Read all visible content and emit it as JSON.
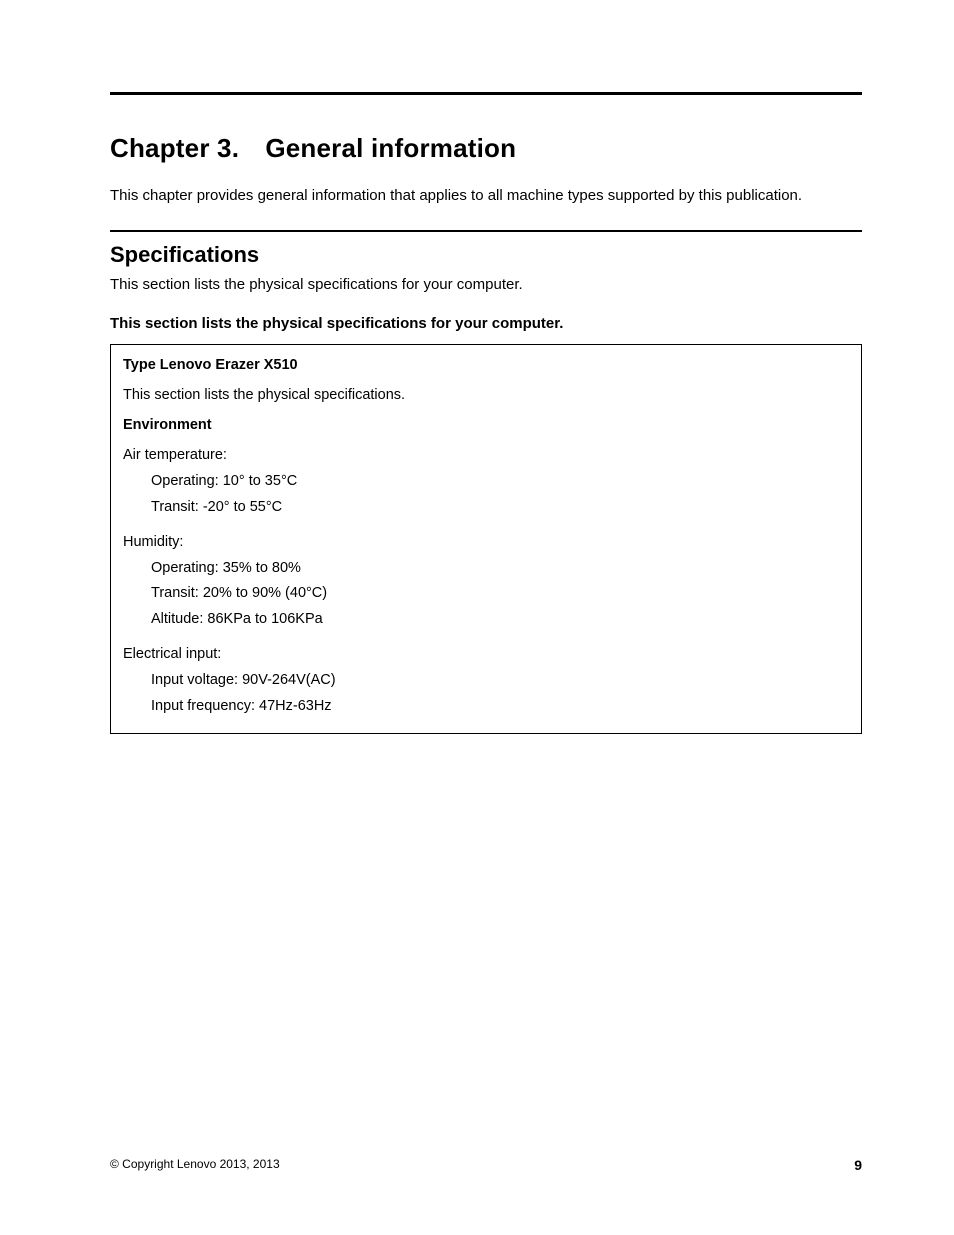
{
  "chapter": {
    "title": "Chapter 3. General information",
    "intro": "This chapter provides general information that applies to all machine types supported by this publication."
  },
  "section": {
    "title": "Specifications",
    "intro": "This section lists the physical specifications for your computer.",
    "subsection_title": "This section lists the physical specifications for your computer."
  },
  "spec": {
    "type_label": "Type Lenovo Erazer X510",
    "desc": "This section lists the physical specifications.",
    "env_label": "Environment",
    "groups": [
      {
        "label": "Air temperature:",
        "items": [
          "Operating: 10° to 35°C",
          "Transit: -20° to 55°C"
        ]
      },
      {
        "label": "Humidity:",
        "items": [
          "Operating: 35% to 80%",
          "Transit: 20% to 90% (40°C)",
          "Altitude: 86KPa to 106KPa"
        ]
      },
      {
        "label": "Electrical input:",
        "items": [
          "Input voltage: 90V-264V(AC)",
          "Input frequency: 47Hz-63Hz"
        ]
      }
    ]
  },
  "footer": {
    "copyright": "© Copyright Lenovo 2013, 2013",
    "page_number": "9"
  }
}
